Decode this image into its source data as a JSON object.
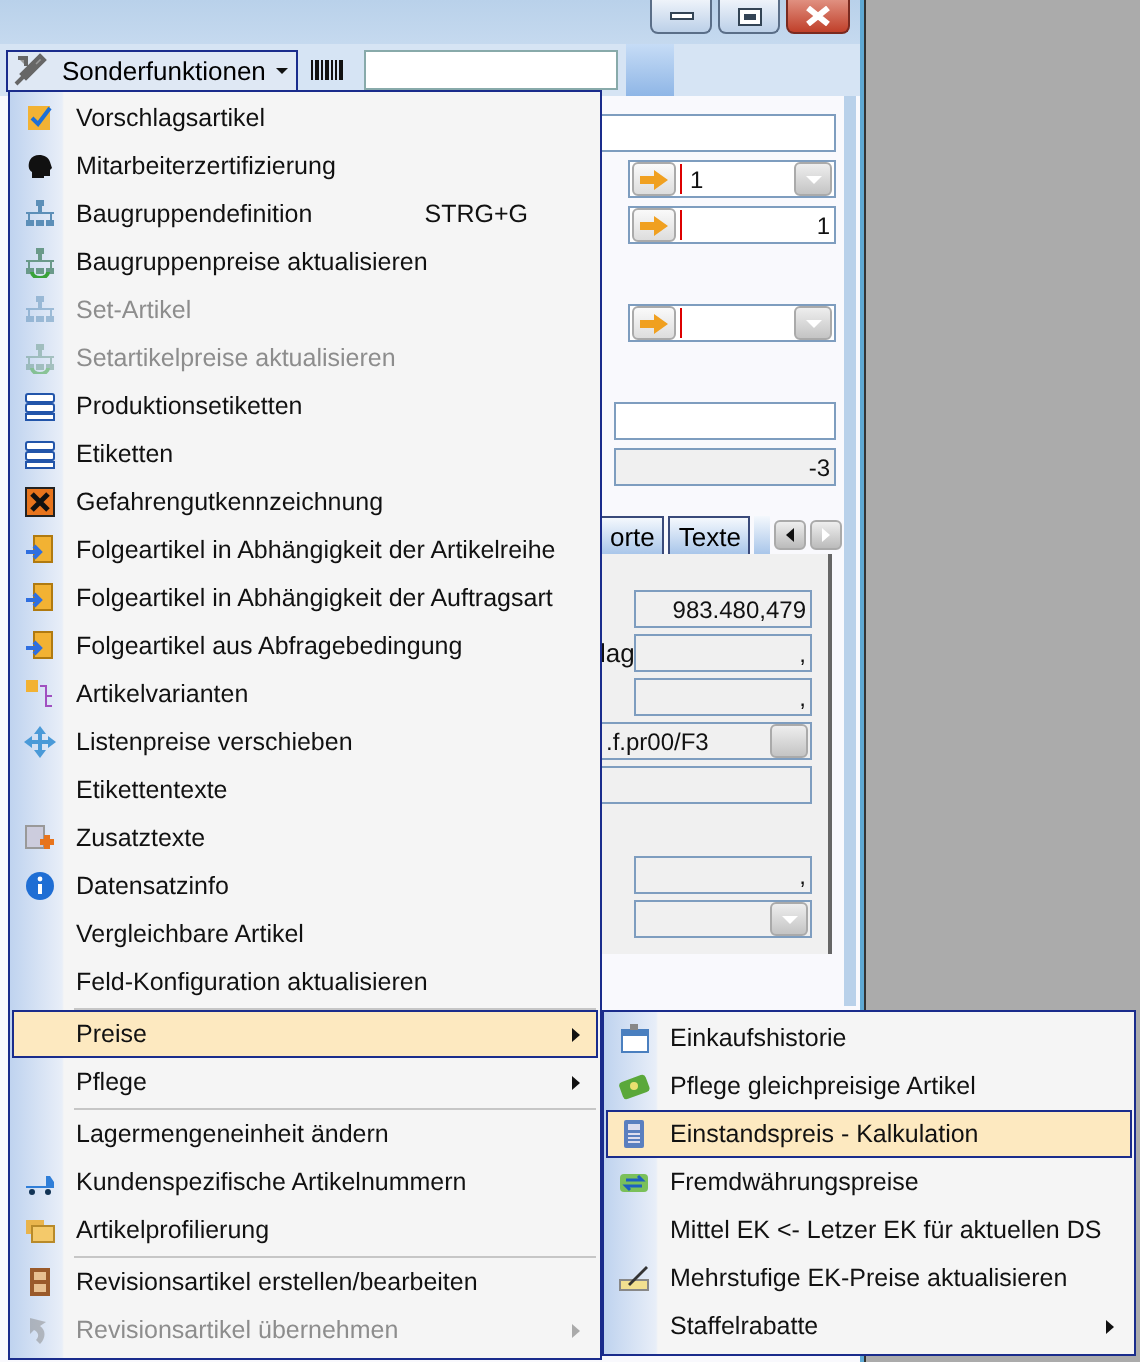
{
  "toolbar": {
    "menu_button": "Sonderfunktionen"
  },
  "form": {
    "fields": [
      {
        "kind": "input"
      },
      {
        "kind": "combo",
        "value": "1"
      },
      {
        "kind": "number",
        "value": "1"
      },
      {
        "kind": "combo"
      },
      {
        "kind": "input"
      },
      {
        "kind": "readonly",
        "value": "-3"
      }
    ],
    "tabs": [
      {
        "label": "orte",
        "selected": false
      },
      {
        "label": "Texte",
        "selected": false
      }
    ],
    "panel": [
      {
        "kind": "readonly",
        "value": "983.480,479"
      },
      {
        "kind": "readonly",
        "label": "lag",
        "value": ","
      },
      {
        "kind": "readonly",
        "value": ","
      },
      {
        "kind": "lookup",
        "value": ".f.pr00/F3"
      },
      {
        "kind": "readonly"
      },
      {
        "kind": "readonly",
        "value": ","
      },
      {
        "kind": "combo-readonly"
      }
    ]
  },
  "menu": [
    {
      "label": "Vorschlagsartikel",
      "disabled": false,
      "submenu": false,
      "selected": false
    },
    {
      "label": "Mitarbeiterzertifizierung",
      "disabled": false,
      "submenu": false,
      "selected": false
    },
    {
      "label": "Baugruppendefinition",
      "shortcut": "STRG+G",
      "disabled": false,
      "submenu": false,
      "selected": false
    },
    {
      "label": "Baugruppenpreise aktualisieren",
      "disabled": false,
      "submenu": false,
      "selected": false
    },
    {
      "label": "Set-Artikel",
      "disabled": true,
      "submenu": false,
      "selected": false
    },
    {
      "label": "Setartikelpreise aktualisieren",
      "disabled": true,
      "submenu": false,
      "selected": false
    },
    {
      "label": "Produktionsetiketten",
      "disabled": false,
      "submenu": false,
      "selected": false
    },
    {
      "label": "Etiketten",
      "disabled": false,
      "submenu": false,
      "selected": false
    },
    {
      "label": "Gefahrengutkennzeichnung",
      "disabled": false,
      "submenu": false,
      "selected": false
    },
    {
      "label": "Folgeartikel in Abhängigkeit der Artikelreihe",
      "disabled": false,
      "submenu": false,
      "selected": false
    },
    {
      "label": "Folgeartikel in Abhängigkeit der Auftragsart",
      "disabled": false,
      "submenu": false,
      "selected": false
    },
    {
      "label": "Folgeartikel aus Abfragebedingung",
      "disabled": false,
      "submenu": false,
      "selected": false
    },
    {
      "label": "Artikelvarianten",
      "disabled": false,
      "submenu": false,
      "selected": false
    },
    {
      "label": "Listenpreise verschieben",
      "disabled": false,
      "submenu": false,
      "selected": false
    },
    {
      "label": "Etikettentexte",
      "disabled": false,
      "submenu": false,
      "selected": false
    },
    {
      "label": "Zusatztexte",
      "disabled": false,
      "submenu": false,
      "selected": false
    },
    {
      "label": "Datensatzinfo",
      "disabled": false,
      "submenu": false,
      "selected": false
    },
    {
      "label": "Vergleichbare Artikel",
      "disabled": false,
      "submenu": false,
      "selected": false
    },
    {
      "label": "Feld-Konfiguration aktualisieren",
      "disabled": false,
      "submenu": false,
      "selected": false
    },
    {
      "label": "Preise",
      "separator_before": true,
      "disabled": false,
      "submenu": true,
      "selected": true
    },
    {
      "label": "Pflege",
      "disabled": false,
      "submenu": true,
      "selected": false
    },
    {
      "label": "Lagermengeneinheit ändern",
      "separator_before": true,
      "disabled": false,
      "submenu": false,
      "selected": false
    },
    {
      "label": "Kundenspezifische Artikelnummern",
      "disabled": false,
      "submenu": false,
      "selected": false
    },
    {
      "label": "Artikelprofilierung",
      "disabled": false,
      "submenu": false,
      "selected": false
    },
    {
      "label": "Revisionsartikel erstellen/bearbeiten",
      "separator_before": true,
      "disabled": false,
      "submenu": false,
      "selected": false
    },
    {
      "label": "Revisionsartikel übernehmen",
      "disabled": true,
      "submenu": true,
      "selected": false
    }
  ],
  "submenu": [
    {
      "label": "Einkaufshistorie",
      "submenu": false,
      "selected": false
    },
    {
      "label": "Pflege gleichpreisige Artikel",
      "submenu": false,
      "selected": false
    },
    {
      "label": "Einstandspreis - Kalkulation",
      "submenu": false,
      "selected": true
    },
    {
      "label": "Fremdwährungspreise",
      "submenu": false,
      "selected": false
    },
    {
      "label": "Mittel EK <- Letzer EK für aktuellen DS",
      "submenu": false,
      "selected": false
    },
    {
      "label": "Mehrstufige EK-Preise aktualisieren",
      "submenu": false,
      "selected": false
    },
    {
      "label": "Staffelrabatte",
      "submenu": true,
      "selected": false
    }
  ]
}
